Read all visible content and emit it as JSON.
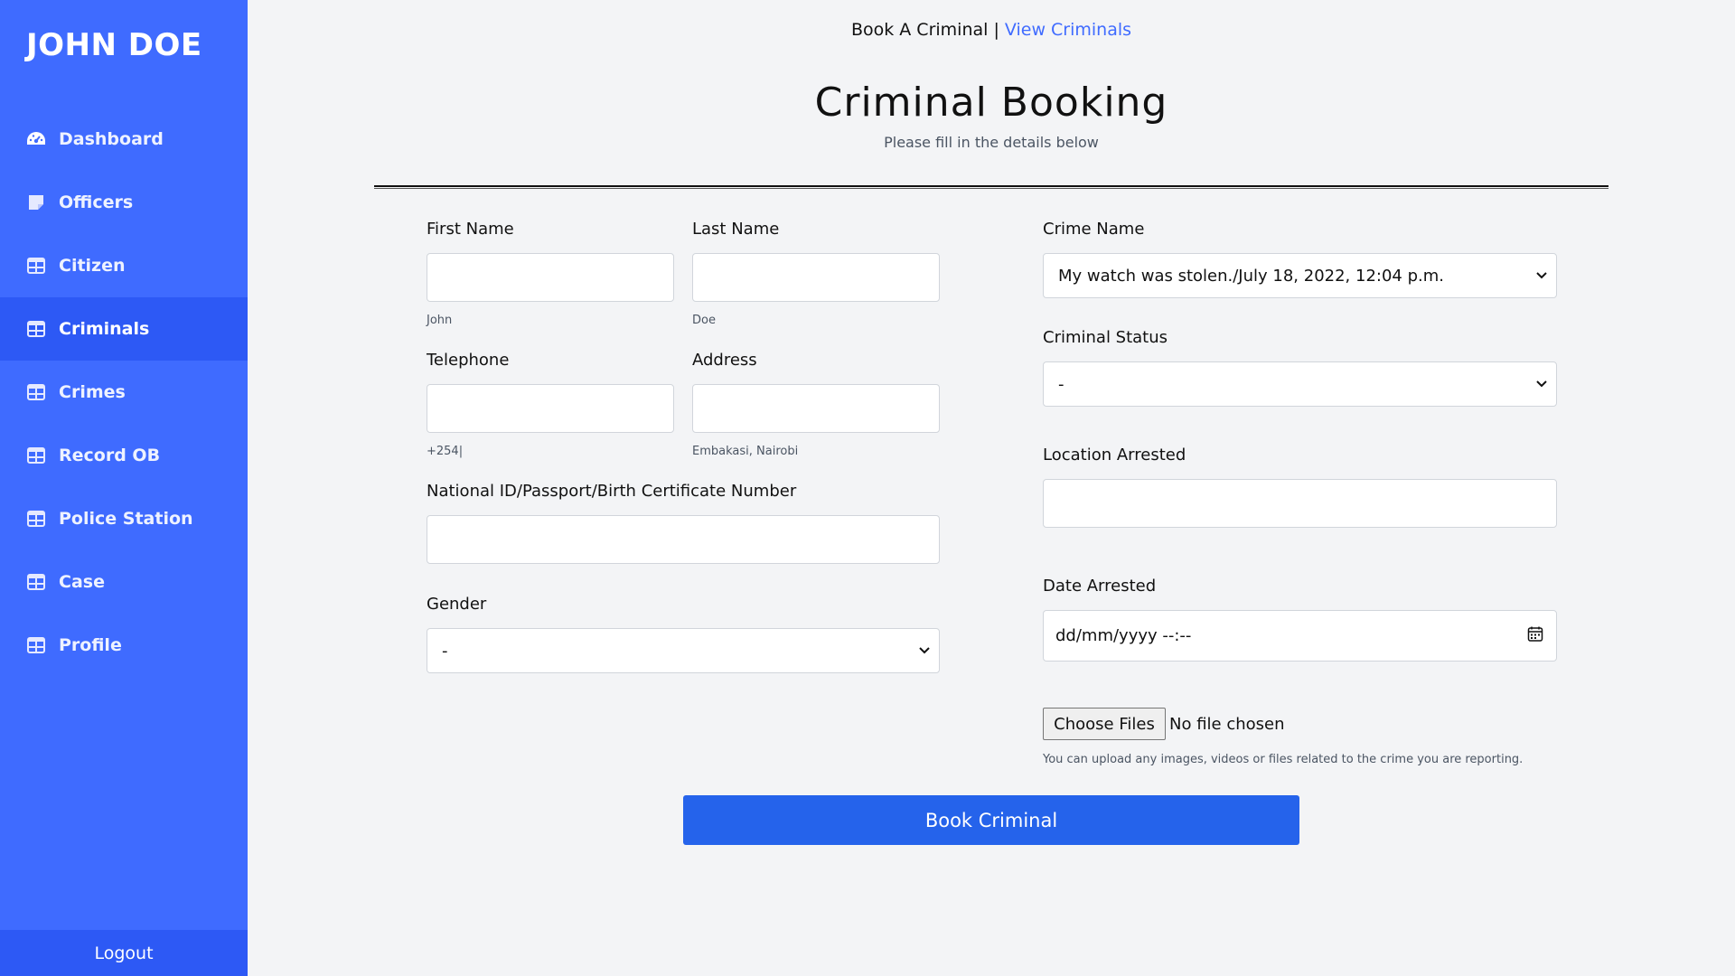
{
  "sidebar": {
    "brand": "JOHN DOE",
    "items": [
      {
        "label": "Dashboard",
        "icon": "dashboard-icon"
      },
      {
        "label": "Officers",
        "icon": "sticky-note-icon"
      },
      {
        "label": "Citizen",
        "icon": "table-icon"
      },
      {
        "label": "Criminals",
        "icon": "table-icon",
        "active": true
      },
      {
        "label": "Crimes",
        "icon": "table-icon"
      },
      {
        "label": "Record OB",
        "icon": "table-icon"
      },
      {
        "label": "Police Station",
        "icon": "table-icon"
      },
      {
        "label": "Case",
        "icon": "table-icon"
      },
      {
        "label": "Profile",
        "icon": "table-icon"
      }
    ],
    "logout": "Logout"
  },
  "topnav": {
    "current": "Book A Criminal",
    "separator": " | ",
    "link": "View Criminals"
  },
  "page": {
    "title": "Criminal Booking",
    "subtitle": "Please fill in the details below"
  },
  "form": {
    "first_name": {
      "label": "First Name",
      "value": "",
      "help": "John"
    },
    "last_name": {
      "label": "Last Name",
      "value": "",
      "help": "Doe"
    },
    "telephone": {
      "label": "Telephone",
      "value": "",
      "help": "+254|"
    },
    "address": {
      "label": "Address",
      "value": "",
      "help": "Embakasi, Nairobi"
    },
    "national_id": {
      "label": "National ID/Passport/Birth Certificate Number",
      "value": ""
    },
    "gender": {
      "label": "Gender",
      "selected": "-"
    },
    "crime_name": {
      "label": "Crime Name",
      "selected": "My watch was stolen./July 18, 2022, 12:04 p.m."
    },
    "criminal_status": {
      "label": "Criminal Status",
      "selected": "-"
    },
    "location_arrested": {
      "label": "Location Arrested",
      "value": ""
    },
    "date_arrested": {
      "label": "Date Arrested",
      "placeholder": "dd/mm/yyyy --:--"
    },
    "files": {
      "button": "Choose Files",
      "status": "No file chosen",
      "help": "You can upload any images, videos or files related to the crime you are reporting."
    },
    "submit": "Book Criminal"
  },
  "colors": {
    "sidebar": "#3f6bff",
    "sidebar_active": "#2d59f5",
    "link": "#3f6bff",
    "button": "#2563eb"
  }
}
